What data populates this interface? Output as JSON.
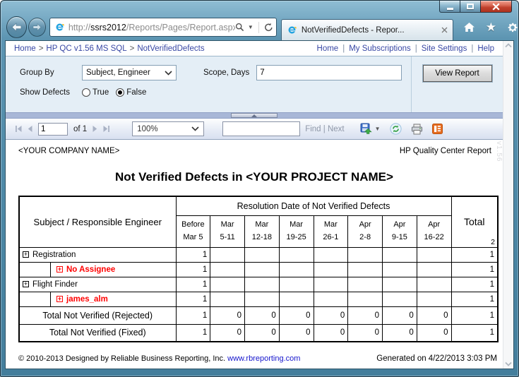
{
  "browser": {
    "url_scheme": "http://",
    "url_host": "ssrs2012",
    "url_path": "/Reports/Pages/Report.aspx?ItemF",
    "tab_title": "NotVerifiedDefects - Repor..."
  },
  "sitebar": {
    "breadcrumb": [
      "Home",
      "HP QC v1.56 MS SQL",
      "NotVerifiedDefects"
    ],
    "separator": ">",
    "pipe": "|",
    "links": [
      "Home",
      "My Subscriptions",
      "Site Settings",
      "Help"
    ]
  },
  "parameters": {
    "group_by_label": "Group By",
    "group_by_value": "Subject, Engineer",
    "scope_label": "Scope, Days",
    "scope_value": "7",
    "show_defects_label": "Show Defects",
    "radio_true_label": "True",
    "radio_false_label": "False",
    "selected_show_defects": "False",
    "view_report_label": "View Report"
  },
  "toolbar": {
    "page_value": "1",
    "of_label": "of 1",
    "zoom_value": "100%",
    "find_label": "Find",
    "next_label": "Next",
    "pipe": "|"
  },
  "report": {
    "company": "<YOUR COMPANY NAME>",
    "header_right": "HP Quality Center Report",
    "watermark": "v1.56",
    "title": "Not Verified Defects in <YOUR PROJECT NAME>",
    "table": {
      "row_header": "Subject / Responsible Engineer",
      "group_header": "Resolution Date of Not Verified Defects",
      "total_header": "Total",
      "total_count": "2",
      "periods": [
        [
          "Before",
          "Mar 5"
        ],
        [
          "Mar",
          "5-11"
        ],
        [
          "Mar",
          "12-18"
        ],
        [
          "Mar",
          "19-25"
        ],
        [
          "Mar",
          "26-1"
        ],
        [
          "Apr",
          "2-8"
        ],
        [
          "Apr",
          "9-15"
        ],
        [
          "Apr",
          "16-22"
        ]
      ],
      "rows": [
        {
          "label": "Registration",
          "indent": 0,
          "red": false,
          "type": "data",
          "values": [
            "1",
            "",
            "",
            "",
            "",
            "",
            "",
            ""
          ],
          "total": "1"
        },
        {
          "label": "No Assignee",
          "indent": 1,
          "red": true,
          "type": "data",
          "values": [
            "1",
            "",
            "",
            "",
            "",
            "",
            "",
            ""
          ],
          "total": "1"
        },
        {
          "label": "Flight Finder",
          "indent": 0,
          "red": false,
          "type": "data",
          "values": [
            "1",
            "",
            "",
            "",
            "",
            "",
            "",
            ""
          ],
          "total": "1"
        },
        {
          "label": "james_alm",
          "indent": 1,
          "red": true,
          "type": "data",
          "values": [
            "1",
            "",
            "",
            "",
            "",
            "",
            "",
            ""
          ],
          "total": "1"
        },
        {
          "label": "Total Not Verified (Rejected)",
          "type": "total",
          "values": [
            "1",
            "0",
            "0",
            "0",
            "0",
            "0",
            "0",
            "0"
          ],
          "total": "1"
        },
        {
          "label": "Total Not Verified (Fixed)",
          "type": "total",
          "values": [
            "1",
            "0",
            "0",
            "0",
            "0",
            "0",
            "0",
            "0"
          ],
          "total": "1"
        }
      ]
    },
    "footer": {
      "copyright": "© 2010-2013 Designed by Reliable Business Reporting, Inc.",
      "link": "www.rbreporting.com",
      "generated": "Generated on 4/22/2013 3:03 PM"
    }
  },
  "colors": {
    "highlight_red": "#ff0000",
    "link_blue": "#3948a5",
    "frame_teal": "#4d88a6",
    "feed_icon_orange": "#e56b1f"
  }
}
